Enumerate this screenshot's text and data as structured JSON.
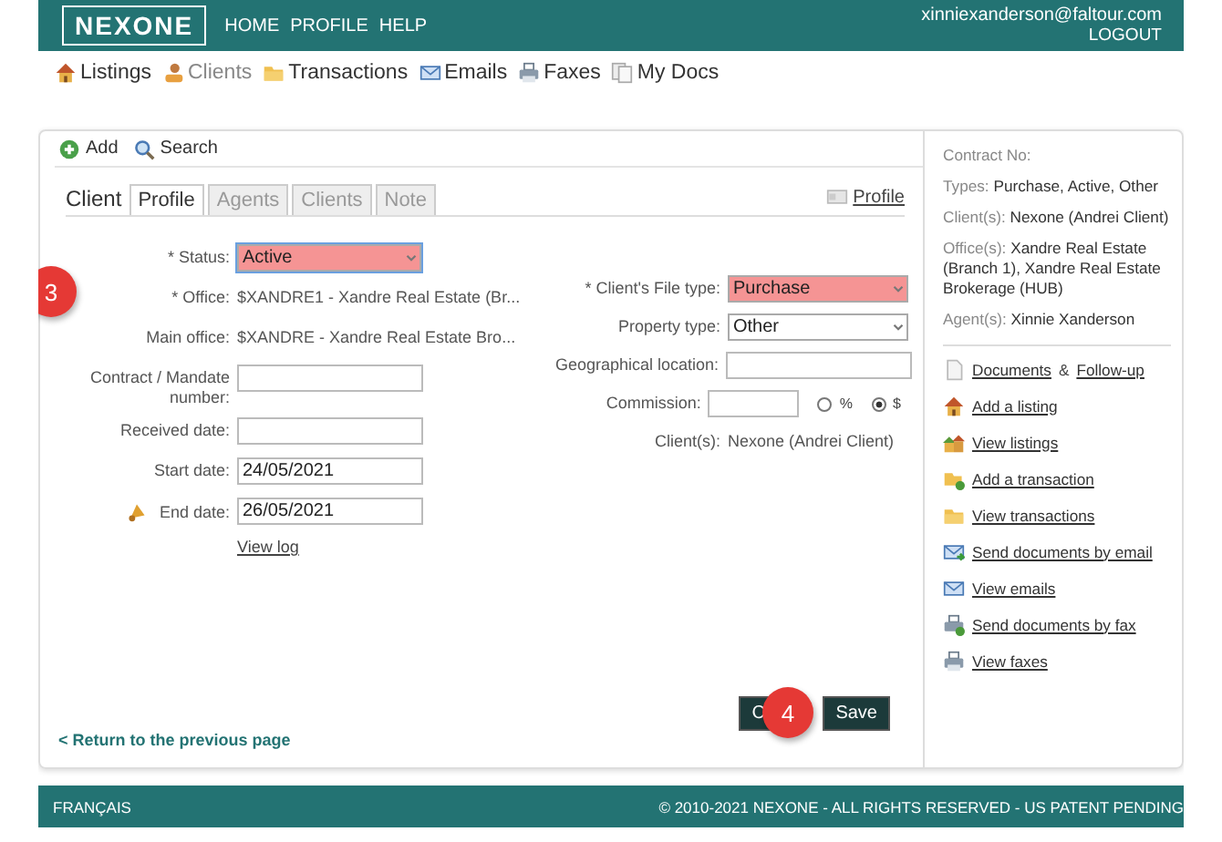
{
  "header": {
    "logo": "NEXONE",
    "nav": [
      "HOME",
      "PROFILE",
      "HELP"
    ],
    "user_email": "xinniexanderson@faltour.com",
    "logout": "LOGOUT"
  },
  "modules": [
    {
      "label": "Listings",
      "selected": false
    },
    {
      "label": "Clients",
      "selected": true
    },
    {
      "label": "Transactions",
      "selected": false
    },
    {
      "label": "Emails",
      "selected": false
    },
    {
      "label": "Faxes",
      "selected": false
    },
    {
      "label": "My Docs",
      "selected": false
    }
  ],
  "toolbar": [
    "Add",
    "Search"
  ],
  "section_title": "Client",
  "tabs": [
    {
      "label": "Profile",
      "selected": true
    },
    {
      "label": "Agents",
      "selected": false
    },
    {
      "label": "Clients",
      "selected": false
    },
    {
      "label": "Note",
      "selected": false
    }
  ],
  "profile_link": "Profile",
  "left_fields": [
    {
      "label": "* Status:",
      "kind": "select",
      "value": "Active",
      "error": true,
      "focused": true
    },
    {
      "label": "* Office:",
      "kind": "text",
      "value": "$XANDRE1 - Xandre Real Estate (Br..."
    },
    {
      "label": "Main office:",
      "kind": "text",
      "value": "$XANDRE - Xandre Real Estate Bro..."
    },
    {
      "label": "Contract / Mandate number:",
      "kind": "input"
    },
    {
      "label": "Received date:",
      "kind": "input"
    },
    {
      "label": "Start date:",
      "kind": "input",
      "value": "24/05/2021"
    },
    {
      "label": "End date:",
      "kind": "input",
      "value": "26/05/2021",
      "alert": true
    }
  ],
  "view_log": "View log",
  "right_fields": [
    {
      "label": "* Client's File type:",
      "kind": "select",
      "value": "Purchase",
      "error": true,
      "focused": false
    },
    {
      "label": "Property type:",
      "kind": "select",
      "value": "Other",
      "error": false,
      "focused": false
    },
    {
      "label": "Geographical location:",
      "kind": "input"
    },
    {
      "label": "Commission:",
      "kind": "commission",
      "options": [
        {
          "label": "%",
          "selected": false
        },
        {
          "label": "$",
          "selected": true
        }
      ]
    },
    {
      "label": "Client(s):",
      "kind": "text",
      "value": "Nexone (Andrei Client)"
    }
  ],
  "return_link": "< Return to the previous page",
  "buttons": [
    {
      "label": "C"
    },
    {
      "label": "Save"
    }
  ],
  "callouts": [
    "3",
    "4"
  ],
  "summary": [
    {
      "label": "Contract No:"
    },
    {
      "label": "Types:",
      "value": "Purchase, Active, Other"
    },
    {
      "label": "Client(s):",
      "value": "Nexone (Andrei Client)"
    },
    {
      "label": "Office(s):",
      "value": "Xandre Real Estate (Branch 1), Xandre Real Estate Brokerage (HUB)"
    },
    {
      "label": "Agent(s):",
      "value": "Xinnie Xanderson"
    }
  ],
  "actions": [
    [
      "Documents",
      "&",
      "Follow-up"
    ],
    [
      "Add a listing"
    ],
    [
      "View listings"
    ],
    [
      "Add a transaction"
    ],
    [
      "View transactions"
    ],
    [
      "Send documents by email"
    ],
    [
      "View emails"
    ],
    [
      "Send documents by fax"
    ],
    [
      "View faxes"
    ]
  ],
  "footer": {
    "language": "FRANÇAIS",
    "copyright": "© 2010-2021 NEXONE - ALL RIGHTS RESERVED - US PATENT PENDING"
  }
}
